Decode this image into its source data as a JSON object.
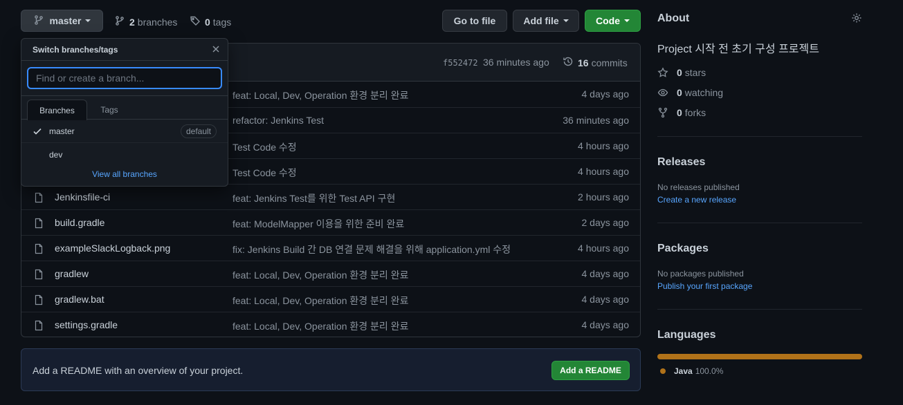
{
  "toolbar": {
    "branch_label": "master",
    "branches_count": "2",
    "branches_label": "branches",
    "tags_count": "0",
    "tags_label": "tags",
    "goto_label": "Go to file",
    "addfile_label": "Add file",
    "code_label": "Code"
  },
  "dropdown": {
    "title": "Switch branches/tags",
    "placeholder": "Find or create a branch...",
    "tab_branches": "Branches",
    "tab_tags": "Tags",
    "items": [
      {
        "name": "master",
        "badge": "default"
      },
      {
        "name": "dev"
      }
    ],
    "view_all": "View all branches"
  },
  "commit_header": {
    "sha": "f552472",
    "time": "36 minutes ago",
    "commits_count": "16",
    "commits_label": "commits"
  },
  "files": [
    {
      "name": "",
      "message": "feat: Local, Dev, Operation 환경 분리 완료",
      "time": "4 days ago"
    },
    {
      "name": "",
      "message": "refactor: Jenkins Test",
      "time": "36 minutes ago"
    },
    {
      "name": "",
      "message": "Test Code 수정",
      "time": "4 hours ago"
    },
    {
      "name": "",
      "message": "Test Code 수정",
      "time": "4 hours ago"
    },
    {
      "name": "Jenkinsfile-ci",
      "message": "feat: Jenkins Test를 위한 Test API 구현",
      "time": "2 hours ago"
    },
    {
      "name": "build.gradle",
      "message": "feat: ModelMapper 이용을 위한 준비 완료",
      "time": "2 days ago"
    },
    {
      "name": "exampleSlackLogback.png",
      "message": "fix: Jenkins Build 간 DB 연결 문제 해결을 위해 application.yml 수정",
      "time": "4 hours ago"
    },
    {
      "name": "gradlew",
      "message": "feat: Local, Dev, Operation 환경 분리 완료",
      "time": "4 days ago"
    },
    {
      "name": "gradlew.bat",
      "message": "feat: Local, Dev, Operation 환경 분리 완료",
      "time": "4 days ago"
    },
    {
      "name": "settings.gradle",
      "message": "feat: Local, Dev, Operation 환경 분리 완료",
      "time": "4 days ago"
    }
  ],
  "readme": {
    "text": "Add a README with an overview of your project.",
    "button": "Add a README"
  },
  "about": {
    "title": "About",
    "description": "Project 시작 전 초기 구성 프로젝트",
    "stars_count": "0",
    "stars_label": "stars",
    "watching_count": "0",
    "watching_label": "watching",
    "forks_count": "0",
    "forks_label": "forks"
  },
  "releases": {
    "title": "Releases",
    "empty": "No releases published",
    "link": "Create a new release"
  },
  "packages": {
    "title": "Packages",
    "empty": "No packages published",
    "link": "Publish your first package"
  },
  "languages": {
    "title": "Languages",
    "items": [
      {
        "name": "Java",
        "percent": "100.0%",
        "fraction": 1.0,
        "color": "#b07219"
      }
    ]
  },
  "colors": {
    "background": "#0d1117",
    "primary_button": "#238636",
    "link": "#58a6ff",
    "focus_border": "#388bfd"
  }
}
